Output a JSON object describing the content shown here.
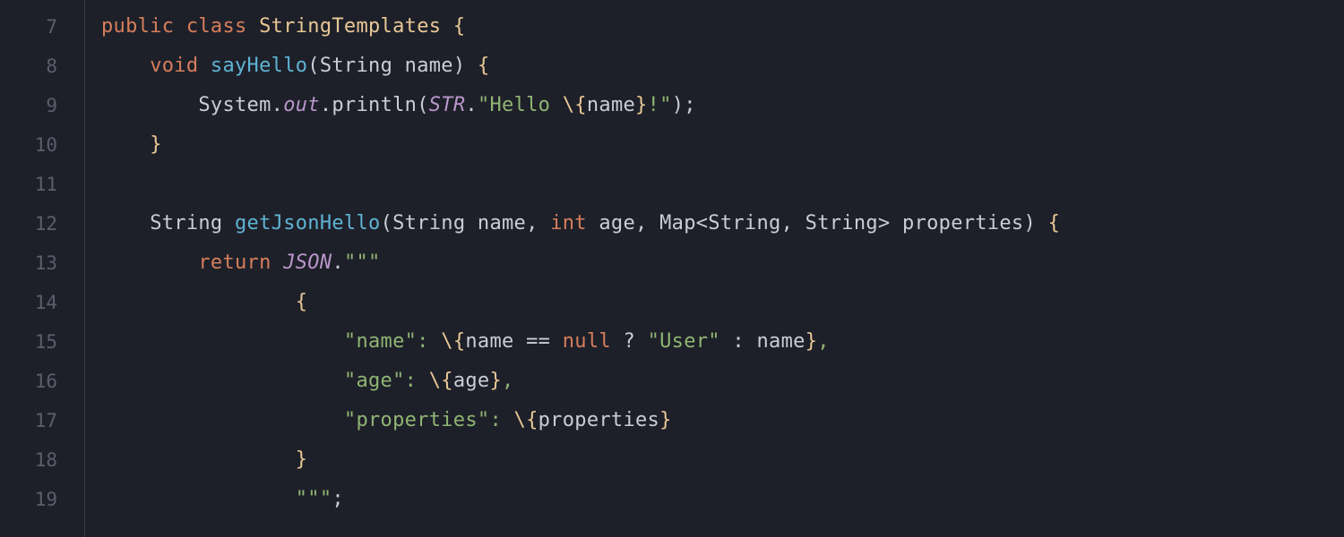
{
  "editor": {
    "startLine": 7,
    "lines": [
      {
        "num": 7,
        "indent": "",
        "tokens": [
          {
            "t": "public",
            "c": "tok-keyword"
          },
          {
            "t": " ",
            "c": ""
          },
          {
            "t": "class",
            "c": "tok-keyword"
          },
          {
            "t": " ",
            "c": ""
          },
          {
            "t": "StringTemplates",
            "c": "tok-class"
          },
          {
            "t": " ",
            "c": ""
          },
          {
            "t": "{",
            "c": "tok-brace"
          }
        ]
      },
      {
        "num": 8,
        "indent": "    ",
        "tokens": [
          {
            "t": "void",
            "c": "tok-keyword"
          },
          {
            "t": " ",
            "c": ""
          },
          {
            "t": "sayHello",
            "c": "tok-method"
          },
          {
            "t": "(",
            "c": "tok-paren"
          },
          {
            "t": "String name",
            "c": "tok-default"
          },
          {
            "t": ")",
            "c": "tok-paren"
          },
          {
            "t": " ",
            "c": ""
          },
          {
            "t": "{",
            "c": "tok-brace"
          }
        ]
      },
      {
        "num": 9,
        "indent": "        ",
        "tokens": [
          {
            "t": "System.",
            "c": "tok-default"
          },
          {
            "t": "out",
            "c": "tok-field"
          },
          {
            "t": ".println(",
            "c": "tok-default"
          },
          {
            "t": "STR",
            "c": "tok-static"
          },
          {
            "t": ".",
            "c": "tok-default"
          },
          {
            "t": "\"Hello ",
            "c": "tok-string"
          },
          {
            "t": "\\{",
            "c": "tok-brace"
          },
          {
            "t": "name",
            "c": "tok-default"
          },
          {
            "t": "}",
            "c": "tok-brace"
          },
          {
            "t": "!\"",
            "c": "tok-string"
          },
          {
            "t": ");",
            "c": "tok-default"
          }
        ]
      },
      {
        "num": 10,
        "indent": "    ",
        "tokens": [
          {
            "t": "}",
            "c": "tok-brace"
          }
        ]
      },
      {
        "num": 11,
        "indent": "",
        "tokens": []
      },
      {
        "num": 12,
        "indent": "    ",
        "tokens": [
          {
            "t": "String ",
            "c": "tok-default"
          },
          {
            "t": "getJsonHello",
            "c": "tok-method"
          },
          {
            "t": "(",
            "c": "tok-paren"
          },
          {
            "t": "String name, ",
            "c": "tok-default"
          },
          {
            "t": "int",
            "c": "tok-keyword"
          },
          {
            "t": " age, Map<String, String> properties",
            "c": "tok-default"
          },
          {
            "t": ")",
            "c": "tok-paren"
          },
          {
            "t": " ",
            "c": ""
          },
          {
            "t": "{",
            "c": "tok-brace"
          }
        ]
      },
      {
        "num": 13,
        "indent": "        ",
        "tokens": [
          {
            "t": "return",
            "c": "tok-keyword"
          },
          {
            "t": " ",
            "c": ""
          },
          {
            "t": "JSON",
            "c": "tok-static"
          },
          {
            "t": ".",
            "c": "tok-default"
          },
          {
            "t": "\"\"\"",
            "c": "tok-string"
          }
        ]
      },
      {
        "num": 14,
        "indent": "                ",
        "tokens": [
          {
            "t": "{",
            "c": "tok-brace"
          }
        ]
      },
      {
        "num": 15,
        "indent": "                    ",
        "tokens": [
          {
            "t": "\"name\": ",
            "c": "tok-string"
          },
          {
            "t": "\\{",
            "c": "tok-brace"
          },
          {
            "t": "name == ",
            "c": "tok-default"
          },
          {
            "t": "null",
            "c": "tok-keyword"
          },
          {
            "t": " ? ",
            "c": "tok-default"
          },
          {
            "t": "\"User\"",
            "c": "tok-string"
          },
          {
            "t": " : name",
            "c": "tok-default"
          },
          {
            "t": "}",
            "c": "tok-brace"
          },
          {
            "t": ",",
            "c": "tok-string"
          }
        ]
      },
      {
        "num": 16,
        "indent": "                    ",
        "tokens": [
          {
            "t": "\"age\": ",
            "c": "tok-string"
          },
          {
            "t": "\\{",
            "c": "tok-brace"
          },
          {
            "t": "age",
            "c": "tok-default"
          },
          {
            "t": "}",
            "c": "tok-brace"
          },
          {
            "t": ",",
            "c": "tok-string"
          }
        ]
      },
      {
        "num": 17,
        "indent": "                    ",
        "tokens": [
          {
            "t": "\"properties\": ",
            "c": "tok-string"
          },
          {
            "t": "\\{",
            "c": "tok-brace"
          },
          {
            "t": "properties",
            "c": "tok-default"
          },
          {
            "t": "}",
            "c": "tok-brace"
          }
        ]
      },
      {
        "num": 18,
        "indent": "                ",
        "tokens": [
          {
            "t": "}",
            "c": "tok-brace"
          }
        ]
      },
      {
        "num": 19,
        "indent": "                ",
        "tokens": [
          {
            "t": "\"\"\"",
            "c": "tok-string"
          },
          {
            "t": ";",
            "c": "tok-default"
          }
        ]
      }
    ]
  }
}
